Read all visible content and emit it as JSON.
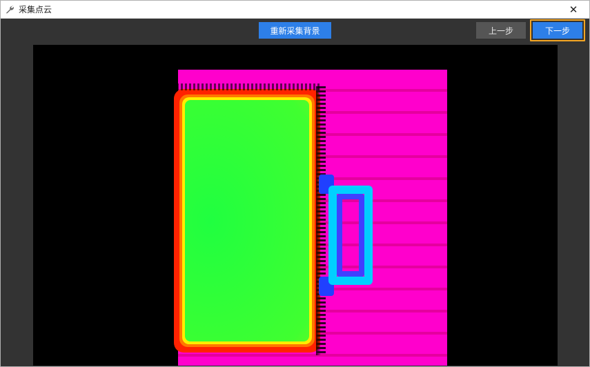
{
  "window": {
    "title": "采集点云",
    "icon_name": "wrench-icon",
    "close_glyph": "✕"
  },
  "toolbar": {
    "recapture_label": "重新采集背景",
    "prev_label": "上一步",
    "next_label": "下一步"
  },
  "colors": {
    "accent": "#2d7fe8",
    "highlight": "#f5a623",
    "toolbar_bg": "#333333",
    "secondary_btn": "#555555"
  }
}
